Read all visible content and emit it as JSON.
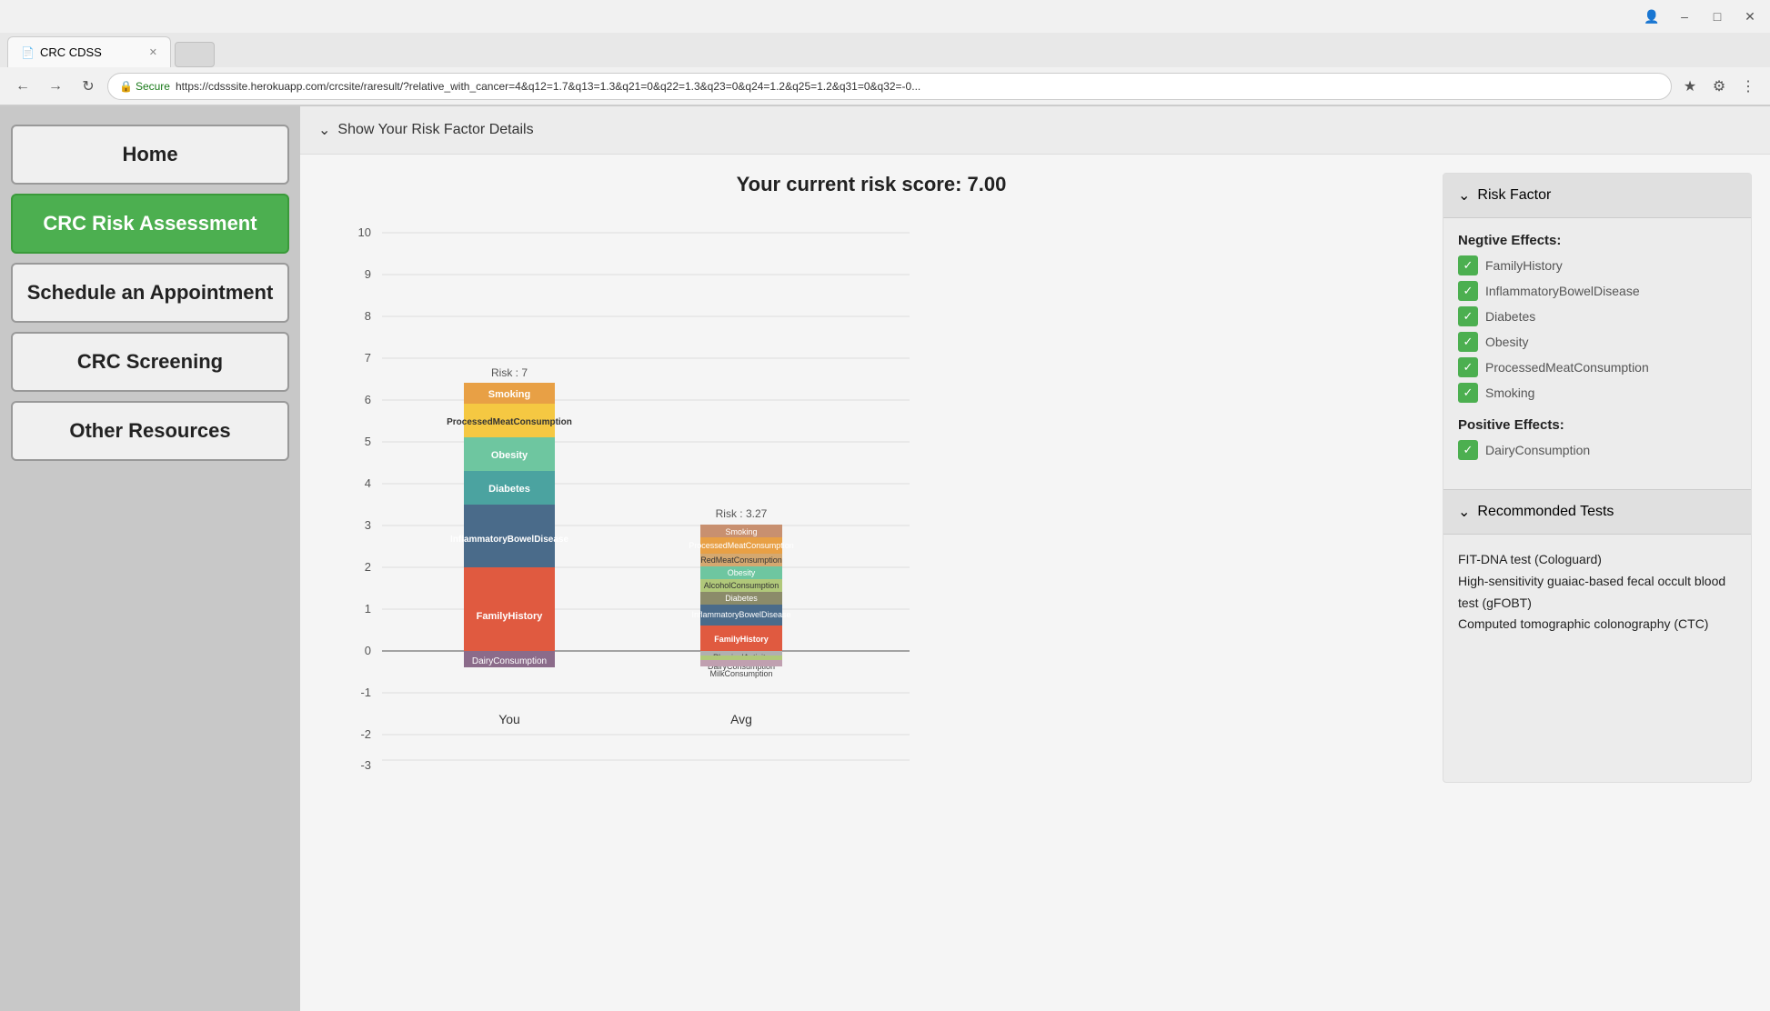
{
  "browser": {
    "tab_title": "CRC CDSS",
    "url": "https://cdsssite.herokuapp.com/crcsite/raresult/?relative_with_cancer=4&q12=1.7&q13=1.3&q21=0&q22=1.3&q23=0&q24=1.2&q25=1.2&q31=0&q32=-0...",
    "secure_label": "Secure"
  },
  "sidebar": {
    "buttons": [
      {
        "id": "home",
        "label": "Home",
        "active": false
      },
      {
        "id": "crc-risk",
        "label": "CRC Risk Assessment",
        "active": true
      },
      {
        "id": "schedule",
        "label": "Schedule an Appointment",
        "active": false
      },
      {
        "id": "crc-screening",
        "label": "CRC Screening",
        "active": false
      },
      {
        "id": "other-resources",
        "label": "Other Resources",
        "active": false
      }
    ]
  },
  "content": {
    "show_risk_factor": "Show Your Risk Factor Details",
    "chart_title": "Your current risk score: 7.00",
    "you_label": "You",
    "avg_label": "Avg",
    "you_risk_label": "Risk : 7",
    "avg_risk_label": "Risk : 3.27"
  },
  "risk_panel": {
    "title": "Risk Factor",
    "negative_effects_title": "Negtive Effects:",
    "negative_effects": [
      "FamilyHistory",
      "InflammatoryBowelDisease",
      "Diabetes",
      "Obesity",
      "ProcessedMeatConsumption",
      "Smoking"
    ],
    "positive_effects_title": "Positive Effects:",
    "positive_effects": [
      "DairyConsumption"
    ],
    "recommended_title": "Recommonded Tests",
    "recommended_tests": [
      "FIT-DNA test (Cologuard)",
      "High-sensitivity guaiac-based fecal occult blood test (gFOBT)",
      "Computed tomographic colonography (CTC)"
    ]
  },
  "chart": {
    "you_bars": [
      {
        "label": "Smoking",
        "color": "#E8A045",
        "value": 0.5
      },
      {
        "label": "ProcessedMeatConsumption",
        "color": "#F5C842",
        "value": 0.8
      },
      {
        "label": "Obesity",
        "color": "#6EC6A0",
        "value": 0.8
      },
      {
        "label": "Diabetes",
        "color": "#4BA3A0",
        "value": 0.8
      },
      {
        "label": "InflammatoryBowelDisease",
        "color": "#4A6B8A",
        "value": 1.5
      },
      {
        "label": "FamilyHistory",
        "color": "#E05A40",
        "value": 2.0
      },
      {
        "label": "DairyConsumption",
        "color": "#8B6B8A",
        "value": -0.4
      }
    ],
    "avg_bars": [
      {
        "label": "Smoking",
        "color": "#C89070",
        "value": 0.3
      },
      {
        "label": "ProcessedMeatConsumption",
        "color": "#E8A045",
        "value": 0.4
      },
      {
        "label": "RedMeatConsumption",
        "color": "#D4A870",
        "value": 0.3
      },
      {
        "label": "Obesity",
        "color": "#6EC6A0",
        "value": 0.3
      },
      {
        "label": "AlcoholConsumption",
        "color": "#B0C87A",
        "value": 0.3
      },
      {
        "label": "Diabetes",
        "color": "#8B8B6A",
        "value": 0.3
      },
      {
        "label": "InflammatoryBowelDisease",
        "color": "#4A6B8A",
        "value": 0.5
      },
      {
        "label": "FamilyHistory",
        "color": "#E05A40",
        "value": 0.6
      },
      {
        "label": "PhysicalActivity",
        "color": "#B0B0B0",
        "value": -0.1
      },
      {
        "label": "DairyConsumption",
        "color": "#B0C87A",
        "value": -0.1
      },
      {
        "label": "MilkConsumption",
        "color": "#C0A0B0",
        "value": -0.15
      }
    ]
  }
}
